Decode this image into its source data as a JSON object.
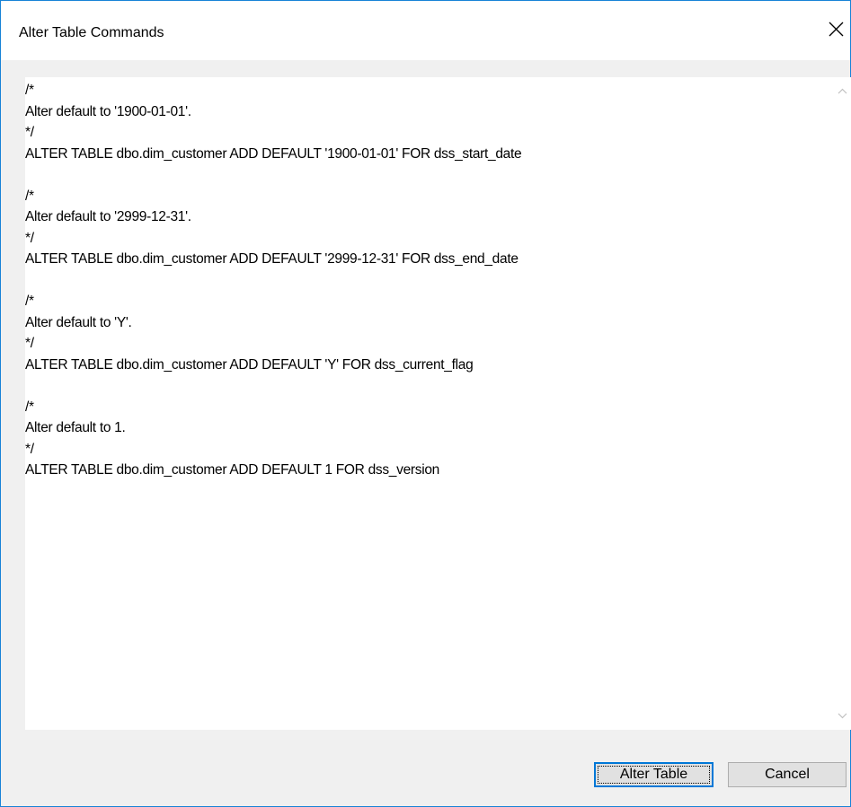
{
  "dialog": {
    "title": "Alter Table Commands",
    "close_icon": "close-icon"
  },
  "editor": {
    "content": "/*\nAlter default to '1900-01-01'.\n*/\nALTER TABLE dbo.dim_customer ADD DEFAULT '1900-01-01' FOR dss_start_date\n\n/*\nAlter default to '2999-12-31'.\n*/\nALTER TABLE dbo.dim_customer ADD DEFAULT '2999-12-31' FOR dss_end_date\n\n/*\nAlter default to 'Y'.\n*/\nALTER TABLE dbo.dim_customer ADD DEFAULT 'Y' FOR dss_current_flag\n\n/*\nAlter default to 1.\n*/\nALTER TABLE dbo.dim_customer ADD DEFAULT 1 FOR dss_version",
    "scroll_up_icon": "chevron-up-icon",
    "scroll_down_icon": "chevron-down-icon"
  },
  "buttons": {
    "alter_label": "Alter Table",
    "cancel_label": "Cancel"
  },
  "colors": {
    "window_border": "#1883d7",
    "dialog_background": "#f0f0f0",
    "editor_background": "#ffffff",
    "button_background": "#e1e1e1",
    "default_button_border": "#0078d7"
  }
}
